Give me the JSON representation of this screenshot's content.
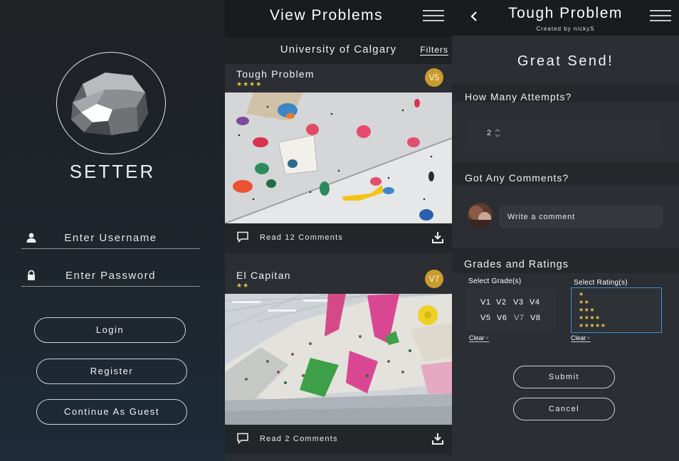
{
  "login": {
    "brand": "SETTER",
    "username_placeholder": "Enter Username",
    "password_placeholder": "Enter Password",
    "login_label": "Login",
    "register_label": "Register",
    "guest_label": "Continue As Guest"
  },
  "view_problems": {
    "title": "View Problems",
    "location": "University of Calgary",
    "filters_label": "Filters",
    "problems": [
      {
        "name": "Tough Problem",
        "stars": "★★★★",
        "grade": "V5",
        "comments_label": "Read 12 Comments"
      },
      {
        "name": "El Capitan",
        "stars": "★★",
        "grade": "V7",
        "comments_label": "Read 2 Comments"
      }
    ]
  },
  "detail": {
    "title": "Tough Problem",
    "creator": "Created by nickyS",
    "banner": "Great Send!",
    "attempts_label": "How Many Attempts?",
    "attempts_value": "2",
    "comments_label": "Got Any Comments?",
    "comment_placeholder": "Write a comment",
    "grades_label": "Grades and Ratings",
    "select_grade_label": "Select Grade(s)",
    "select_rating_label": "Select Rating(s)",
    "grades": [
      "V1",
      "V2",
      "V3",
      "V4",
      "V5",
      "V6",
      "V7",
      "V8"
    ],
    "ratings": [
      "★",
      "★★",
      "★★★",
      "★★★★",
      "★★★★★"
    ],
    "clear_label": "Clear",
    "clear_x": "×",
    "submit_label": "Submit",
    "cancel_label": "Cancel"
  },
  "colors": {
    "accent_blue": "#3a8fd8",
    "grade_badge": "#c99a2e",
    "star": "#e8c547",
    "header": "#1a1b1d"
  },
  "icons": [
    "boulder-logo-icon",
    "user-icon",
    "lock-icon",
    "menu-icon",
    "comment-icon",
    "download-icon",
    "back-icon",
    "stepper-icon"
  ]
}
